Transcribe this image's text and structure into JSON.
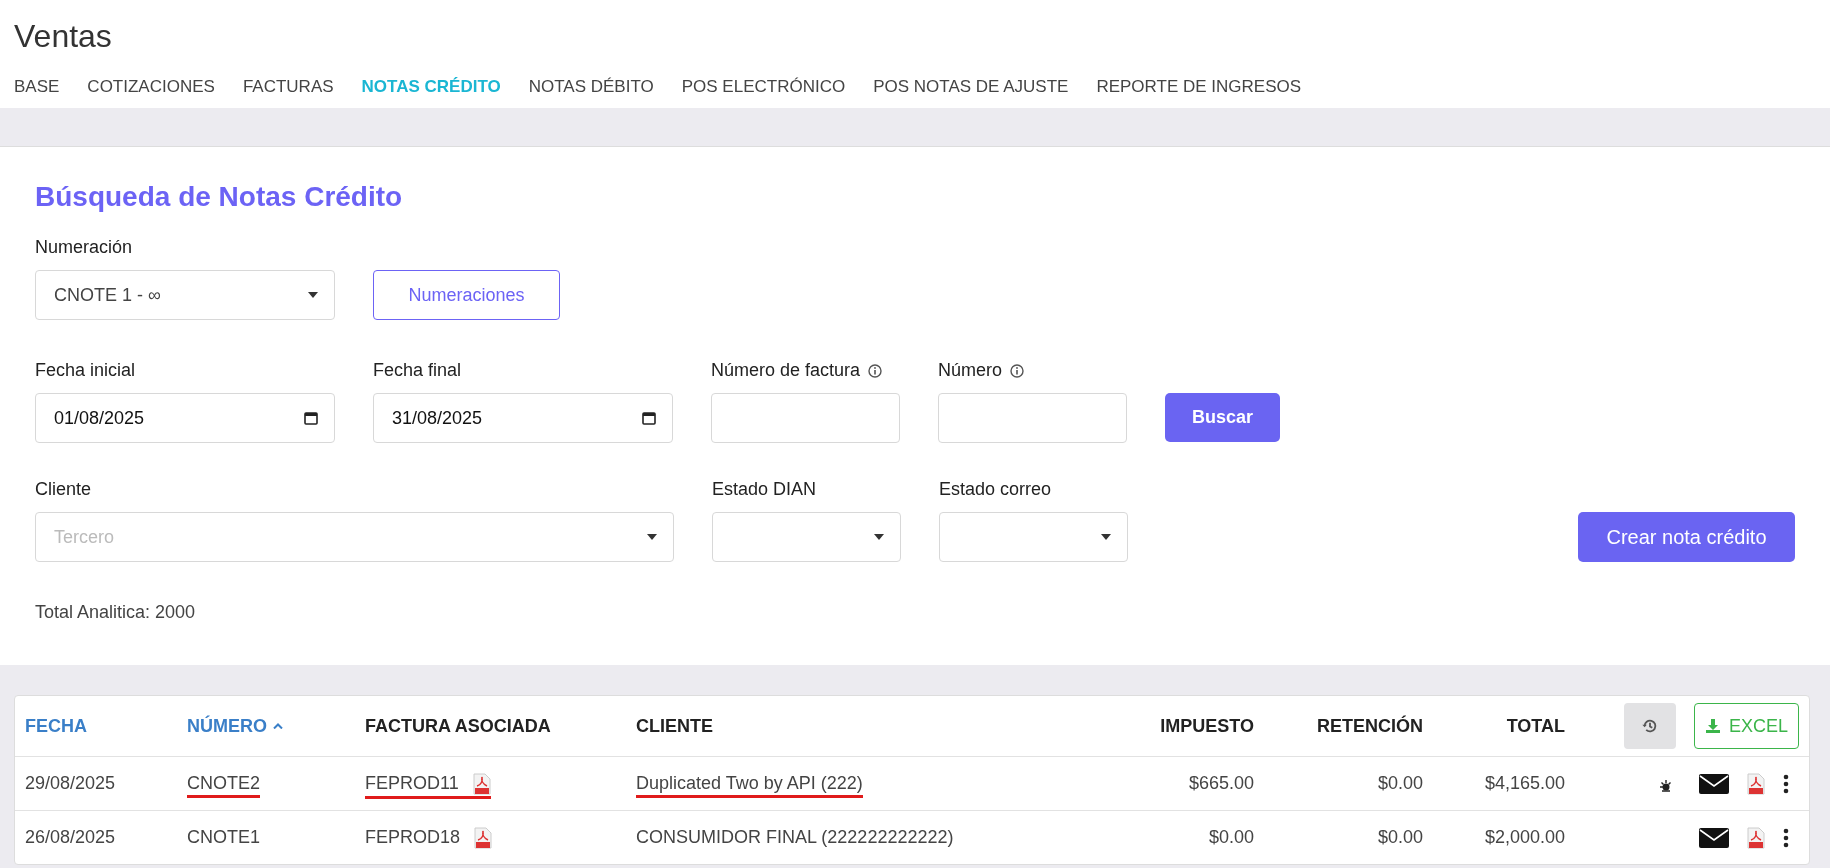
{
  "page": {
    "title": "Ventas"
  },
  "tabs": [
    {
      "label": "BASE",
      "selected": false
    },
    {
      "label": "COTIZACIONES",
      "selected": false
    },
    {
      "label": "FACTURAS",
      "selected": false
    },
    {
      "label": "NOTAS CRÉDITO",
      "selected": true
    },
    {
      "label": "NOTAS DÉBITO",
      "selected": false
    },
    {
      "label": "POS ELECTRÓNICO",
      "selected": false
    },
    {
      "label": "POS NOTAS DE AJUSTE",
      "selected": false
    },
    {
      "label": "REPORTE DE INGRESOS",
      "selected": false
    }
  ],
  "search": {
    "title": "Búsqueda de Notas Crédito",
    "numeracion": {
      "label": "Numeración",
      "value": "CNOTE 1 - ∞"
    },
    "numeraciones_button": "Numeraciones",
    "fecha_inicial": {
      "label": "Fecha inicial",
      "value": "01/08/2025"
    },
    "fecha_final": {
      "label": "Fecha final",
      "value": "31/08/2025"
    },
    "numero_factura": {
      "label": "Número de factura"
    },
    "numero": {
      "label": "Número"
    },
    "buscar_button": "Buscar",
    "cliente": {
      "label": "Cliente",
      "placeholder": "Tercero"
    },
    "estado_dian": {
      "label": "Estado DIAN"
    },
    "estado_correo": {
      "label": "Estado correo"
    },
    "crear_button": "Crear nota crédito",
    "total": "Total Analitica: 2000"
  },
  "table": {
    "columns": [
      {
        "label": "FECHA",
        "sortable": true,
        "sorted": false
      },
      {
        "label": "NÚMERO",
        "sortable": true,
        "sorted": true
      },
      {
        "label": "FACTURA ASOCIADA",
        "sortable": false,
        "sorted": false
      },
      {
        "label": "CLIENTE",
        "sortable": false,
        "sorted": false
      },
      {
        "label": "IMPUESTO",
        "sortable": false,
        "sorted": false
      },
      {
        "label": "RETENCIÓN",
        "sortable": false,
        "sorted": false
      },
      {
        "label": "TOTAL",
        "sortable": false,
        "sorted": false
      }
    ],
    "excel_button": "EXCEL",
    "rows": [
      {
        "fecha": "29/08/2025",
        "numero": {
          "text": "CNOTE2",
          "underlined": true
        },
        "factura": {
          "text": "FEPROD11",
          "underlined": true
        },
        "cliente": {
          "text": "Duplicated Two by API (222)",
          "underlined": true
        },
        "impuesto": "$665.00",
        "retencion": "$0.00",
        "total": "$4,165.00",
        "status_icon": true
      },
      {
        "fecha": "26/08/2025",
        "numero": {
          "text": "CNOTE1",
          "underlined": false
        },
        "factura": {
          "text": "FEPROD18",
          "underlined": false
        },
        "cliente": {
          "text": "CONSUMIDOR FINAL (222222222222)",
          "underlined": false
        },
        "impuesto": "$0.00",
        "retencion": "$0.00",
        "total": "$2,000.00",
        "status_icon": false
      }
    ]
  }
}
